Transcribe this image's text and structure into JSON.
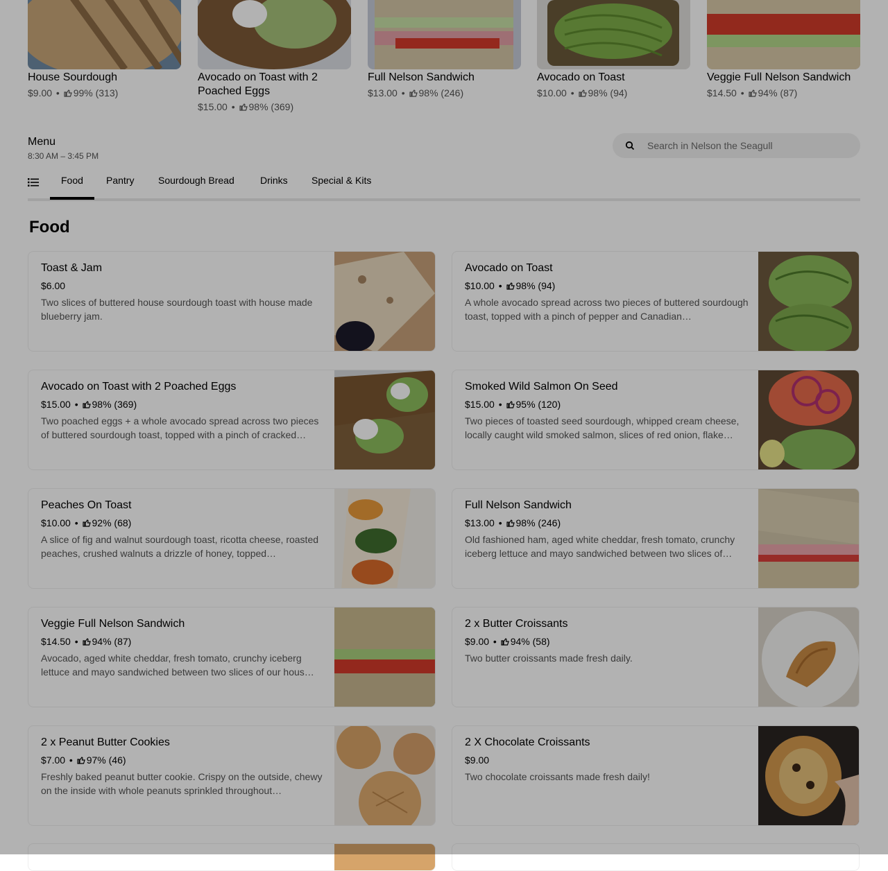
{
  "featured": [
    {
      "name": "House Sourdough",
      "price": "$9.00",
      "rating": "99% (313)"
    },
    {
      "name": "Avocado on Toast with 2 Poached Eggs",
      "price": "$15.00",
      "rating": "98% (369)"
    },
    {
      "name": "Full Nelson Sandwich",
      "price": "$13.00",
      "rating": "98% (246)"
    },
    {
      "name": "Avocado on Toast",
      "price": "$10.00",
      "rating": "98% (94)"
    },
    {
      "name": "Veggie Full Nelson Sandwich",
      "price": "$14.50",
      "rating": "94% (87)"
    }
  ],
  "menu": {
    "title": "Menu",
    "hours": "8:30 AM – 3:45 PM",
    "search_placeholder": "Search in Nelson the Seagull",
    "tabs": [
      "Food",
      "Pantry",
      "Sourdough Bread",
      "Drinks",
      "Special & Kits"
    ],
    "active_tab": "Food"
  },
  "section_title": "Food",
  "items": [
    {
      "name": "Toast & Jam",
      "price": "$6.00",
      "rating": "",
      "desc": "Two slices of buttered house sourdough toast with house made blueberry jam."
    },
    {
      "name": "Avocado on Toast",
      "price": "$10.00",
      "rating": "98% (94)",
      "desc": "A whole avocado spread across two pieces of buttered sourdough toast, topped with a pinch of pepper and Canadian…"
    },
    {
      "name": "Avocado on Toast with 2 Poached Eggs",
      "price": "$15.00",
      "rating": "98% (369)",
      "desc": "Two poached eggs + a whole avocado spread across two pieces of buttered sourdough toast, topped with a pinch of cracked…"
    },
    {
      "name": "Smoked Wild Salmon On Seed",
      "price": "$15.00",
      "rating": "95% (120)",
      "desc": "Two pieces of toasted seed sourdough, whipped cream cheese, locally caught wild smoked salmon, slices of red onion, flake…"
    },
    {
      "name": "Peaches On Toast",
      "price": "$10.00",
      "rating": "92% (68)",
      "desc": "A slice of fig and walnut sourdough toast, ricotta cheese, roasted peaches, crushed walnuts a drizzle of honey, topped…"
    },
    {
      "name": "Full Nelson Sandwich",
      "price": "$13.00",
      "rating": "98% (246)",
      "desc": "Old fashioned ham, aged white cheddar, fresh tomato, crunchy iceberg lettuce and mayo sandwiched between two slices of…"
    },
    {
      "name": "Veggie Full Nelson Sandwich",
      "price": "$14.50",
      "rating": "94% (87)",
      "desc": "Avocado, aged white cheddar, fresh tomato, crunchy iceberg lettuce and mayo sandwiched between two slices of our hous…"
    },
    {
      "name": "2 x Butter Croissants",
      "price": "$9.00",
      "rating": "94% (58)",
      "desc": "Two butter croissants made fresh daily."
    },
    {
      "name": "2 x Peanut Butter Cookies",
      "price": "$7.00",
      "rating": "97% (46)",
      "desc": "Freshly baked peanut butter cookie. Crispy on the outside, chewy on the inside with whole peanuts sprinkled throughout…"
    },
    {
      "name": "2 X Chocolate Croissants",
      "price": "$9.00",
      "rating": "",
      "desc": "Two chocolate croissants made fresh daily!"
    }
  ],
  "colors": {
    "overlay": "#0000004d",
    "tab_active": "#000000",
    "muted": "#545454"
  },
  "icons": [
    "thumbs-up-icon",
    "search-icon",
    "list-icon"
  ]
}
